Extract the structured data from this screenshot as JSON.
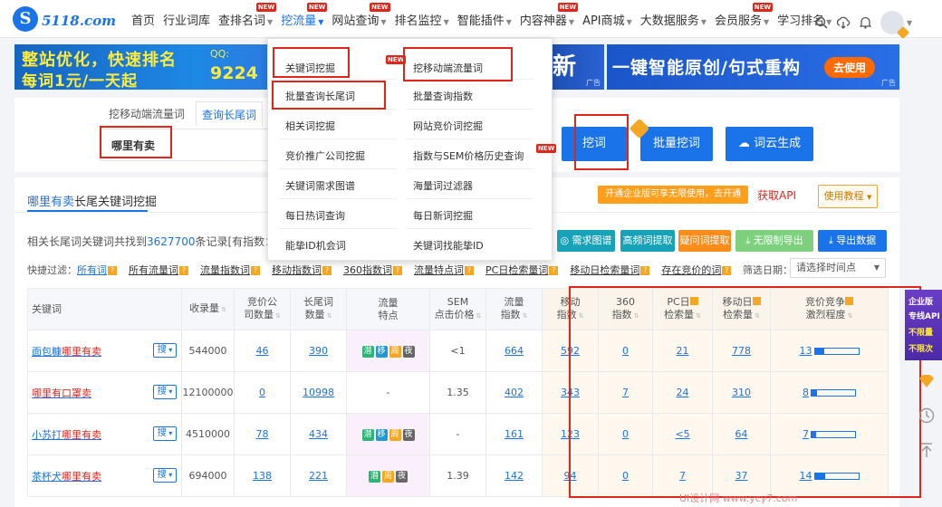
{
  "brand": {
    "logo_mark": "S",
    "name": "5118",
    "suffix": ".com"
  },
  "nav": {
    "items": [
      {
        "label": "首页",
        "caret": false,
        "badge": ""
      },
      {
        "label": "行业词库",
        "caret": false,
        "badge": ""
      },
      {
        "label": "查排名词",
        "caret": true,
        "badge": "NEW"
      },
      {
        "label": "挖流量",
        "caret": true,
        "badge": "NEW",
        "active": true
      },
      {
        "label": "网站查询",
        "caret": true,
        "badge": "NEW"
      },
      {
        "label": "排名监控",
        "caret": true,
        "badge": ""
      },
      {
        "label": "智能插件",
        "caret": true,
        "badge": ""
      },
      {
        "label": "内容神器",
        "caret": true,
        "badge": "NEW"
      },
      {
        "label": "API商城",
        "caret": true,
        "badge": ""
      },
      {
        "label": "大数据服务",
        "caret": true,
        "badge": ""
      },
      {
        "label": "会员服务",
        "caret": true,
        "badge": "NEW"
      },
      {
        "label": "学习排名",
        "caret": true,
        "badge": ""
      }
    ]
  },
  "header_icons": [
    "search-icon",
    "cloud-download-icon",
    "bell-icon",
    "avatar"
  ],
  "banners": {
    "left": {
      "line1": "整站优化，快速排名",
      "line2": "每词1元/一天起",
      "qq_label": "QQ:",
      "qq_number": "9224"
    },
    "mid": {
      "text": "新",
      "ad": "广告"
    },
    "right": {
      "text": "一键智能原创/句式重构",
      "button": "去使用",
      "ad": "广告"
    }
  },
  "search": {
    "tabs": [
      {
        "label": "挖移动端流量词",
        "active": false
      },
      {
        "label": "查询长尾词",
        "active": true
      }
    ],
    "query": "哪里有卖",
    "buttons": {
      "dig": "挖词",
      "batch": "批量挖词",
      "cloud": "词云生成"
    }
  },
  "dropdown": {
    "left": [
      "关键词挖掘",
      "批量查询长尾词",
      "相关词挖掘",
      "竞价推广公司挖掘",
      "关键词需求图谱",
      "每日热词查询",
      "能挚ID机会词"
    ],
    "right": [
      "挖移动端流量词",
      "批量查询指数",
      "网站竞价词挖掘",
      "指数与SEM价格历史查询",
      "海量词过滤器",
      "每日新词挖掘",
      "关键词找能挚ID"
    ],
    "right_badge": "NEW"
  },
  "card": {
    "title_highlight": "哪里有卖",
    "title_rest": "长尾关键词挖掘",
    "promo": "开通企业版可享无限使用，去开通",
    "api": "获取API",
    "help": "使用教程",
    "summary_prefix": "相关长尾词关键词共找到",
    "summary_count": "3627700",
    "summary_suffix": "条记录[有指数：40",
    "actions": [
      {
        "label": "需求图谱",
        "color": "#17a2b8"
      },
      {
        "label": "高频词提取",
        "color": "#17a2b8"
      },
      {
        "label": "疑问词提取",
        "color": "#ff8c1a"
      },
      {
        "label": "无限制导出",
        "color": "#7ed07e"
      },
      {
        "label": "导出数据",
        "color": "#1a73e8"
      }
    ],
    "filter_label": "快捷过滤：",
    "filters": [
      "所有词",
      "所有流量词",
      "流量指数词",
      "移动指数词",
      "360指数词",
      "流量特点词",
      "PC日检索量词",
      "移动日检索量词",
      "存在竞价的词"
    ],
    "date_label": "筛选日期：",
    "date_placeholder": "请选择时间点"
  },
  "table": {
    "headers": {
      "keyword": "关键词",
      "collected": "收录量",
      "bidcos": [
        "竞价公",
        "司数量"
      ],
      "longtail": [
        "长尾词",
        "数量"
      ],
      "flow": [
        "流量",
        "特点"
      ],
      "sem": [
        "SEM",
        "点击价格"
      ],
      "flowidx": [
        "流量",
        "指数"
      ],
      "mobile": [
        "移动",
        "指数"
      ],
      "s360": [
        "360",
        "指数"
      ],
      "pc": [
        "PC日",
        "检索量"
      ],
      "mday": [
        "移动日",
        "检索量"
      ],
      "compete": [
        "竞价竞争",
        "激烈程度"
      ]
    },
    "search_btn": "搜",
    "rows": [
      {
        "kw_pre": "面包糠",
        "kw_hl": "哪里有卖",
        "kw_post": "",
        "collected": "544000",
        "bidcos": "46",
        "longtail": "390",
        "tags": [
          "潜",
          "移",
          "周",
          "夜"
        ],
        "sem": "<1",
        "flowidx": "664",
        "mobile": "592",
        "s360": "0",
        "pc": "21",
        "mday": "778",
        "compete": "13",
        "compete_level": 0.22
      },
      {
        "kw_pre": "",
        "kw_hl": "哪里有口罩卖",
        "kw_post": "",
        "collected": "12100000",
        "bidcos": "0",
        "longtail": "10998",
        "tags": [],
        "sem": "1.35",
        "flowidx": "402",
        "mobile": "343",
        "s360": "7",
        "pc": "24",
        "mday": "310",
        "compete": "8",
        "compete_level": 0.12
      },
      {
        "kw_pre": "小苏打",
        "kw_hl": "哪里有卖",
        "kw_post": "",
        "collected": "4510000",
        "bidcos": "78",
        "longtail": "434",
        "tags": [
          "潜",
          "移",
          "周",
          "夜"
        ],
        "sem": "-",
        "flowidx": "161",
        "mobile": "123",
        "s360": "0",
        "pc": "<5",
        "mday": "64",
        "compete": "7",
        "compete_level": 0.1
      },
      {
        "kw_pre": "茶杯犬",
        "kw_hl": "哪里有卖",
        "kw_post": "",
        "collected": "694000",
        "bidcos": "138",
        "longtail": "221",
        "tags": [
          "潜",
          "周",
          "夜"
        ],
        "sem": "1.39",
        "flowidx": "142",
        "mobile": "94",
        "s360": "0",
        "pc": "7",
        "mday": "37",
        "compete": "14",
        "compete_level": 0.24
      }
    ],
    "flow_dash": "-"
  },
  "float_ad": {
    "l1": "企业版",
    "l2": "专线API",
    "l3": "不限量",
    "l4": "不限次"
  },
  "side_icons": [
    "vip-diamond-icon",
    "clock-icon",
    "back-to-top-icon"
  ],
  "watermark": "UI设计网 www.ycy7.com"
}
